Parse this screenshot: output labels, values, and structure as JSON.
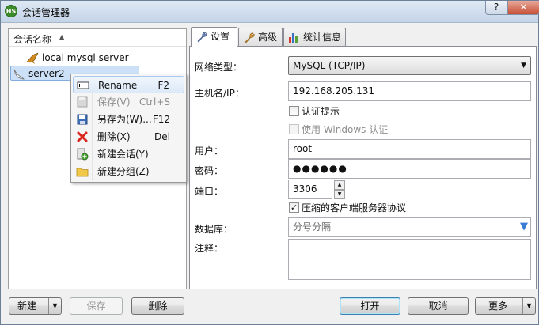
{
  "window": {
    "title": "会话管理器",
    "app_icon_text": "HS",
    "help_glyph": "?",
    "close_glyph": "✕"
  },
  "session_tree": {
    "header": "会话名称",
    "sort_glyph": "▲",
    "items": [
      {
        "label": "local mysql server",
        "icon": "dolphin-icon"
      },
      {
        "label": "server2",
        "icon": "dolphin-icon"
      }
    ]
  },
  "context_menu": {
    "items": [
      {
        "label": "Rename",
        "shortcut": "F2",
        "icon": "rename-icon",
        "state": "highlighted"
      },
      {
        "label": "保存(V)",
        "shortcut": "Ctrl+S",
        "icon": "save-icon",
        "state": "disabled"
      },
      {
        "label": "另存为(W)...",
        "shortcut": "F12",
        "icon": "save-as-icon",
        "state": "normal"
      },
      {
        "label": "删除(X)",
        "shortcut": "Del",
        "icon": "delete-icon",
        "state": "normal"
      },
      {
        "label": "新建会话(Y)",
        "shortcut": "",
        "icon": "new-session-icon",
        "state": "normal"
      },
      {
        "label": "新建分组(Z)",
        "shortcut": "",
        "icon": "folder-icon",
        "state": "normal"
      }
    ]
  },
  "left_buttons": {
    "new": "新建",
    "save": "保存",
    "delete": "删除",
    "arrow_glyph": "▼"
  },
  "tabs": [
    {
      "label": "设置",
      "icon": "wrench-icon",
      "active": true
    },
    {
      "label": "高级",
      "icon": "wrench-icon",
      "active": false
    },
    {
      "label": "统计信息",
      "icon": "bar-chart-icon",
      "active": false
    }
  ],
  "settings": {
    "network_type_label": "网络类型：",
    "network_type_value": "MySQL (TCP/IP)",
    "host_label": "主机名/IP：",
    "host_value": "192.168.205.131",
    "auth_prompt_label": "认证提示",
    "auth_prompt_checked": false,
    "windows_auth_label": "使用 Windows 认证",
    "windows_auth_checked": false,
    "user_label": "用户：",
    "user_value": "root",
    "password_label": "密码：",
    "password_value": "●●●●●●",
    "port_label": "端口：",
    "port_value": "3306",
    "spin_up": "▲",
    "spin_down": "▼",
    "compress_label": "压缩的客户端服务器协议",
    "compress_checked": true,
    "check_glyph": "✓",
    "database_label": "数据库：",
    "database_placeholder": "分号分隔",
    "comment_label": "注释：",
    "comment_value": ""
  },
  "bottom_buttons": {
    "open": "打开",
    "cancel": "取消",
    "more": "更多",
    "arrow_glyph": "▼"
  },
  "colors": {
    "selection": "#cce1f7",
    "delete_red": "#d8261c",
    "dropdown_arrow": "#3a7bd5"
  }
}
